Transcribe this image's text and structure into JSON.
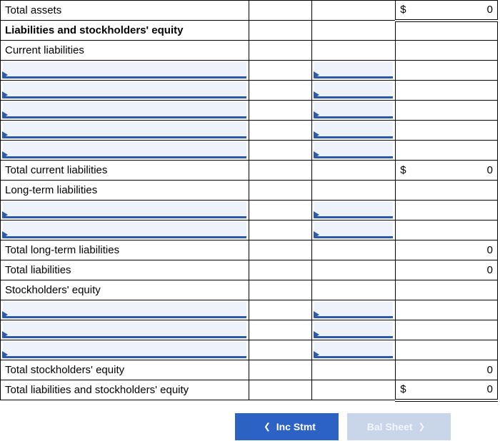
{
  "rows": {
    "total_assets": {
      "label": "Total assets",
      "currency": "$",
      "value": "0"
    },
    "liab_equity_header": {
      "label": "Liabilities and stockholders' equity"
    },
    "current_liabilities": {
      "label": "Current liabilities"
    },
    "total_current_liabilities": {
      "label": "Total current liabilities",
      "currency": "$",
      "value": "0"
    },
    "long_term_liabilities": {
      "label": "Long-term liabilities"
    },
    "total_long_term_liabilities": {
      "label": "Total long-term liabilities",
      "currency": "",
      "value": "0"
    },
    "total_liabilities": {
      "label": "Total liabilities",
      "currency": "",
      "value": "0"
    },
    "stockholders_equity": {
      "label": "Stockholders' equity"
    },
    "total_stockholders_equity": {
      "label": "Total stockholders' equity",
      "currency": "",
      "value": "0"
    },
    "total_liab_and_equity": {
      "label": "Total liabilities and stockholders' equity",
      "currency": "$",
      "value": "0"
    }
  },
  "nav": {
    "prev": "Inc Stmt",
    "next": "Bal Sheet"
  }
}
